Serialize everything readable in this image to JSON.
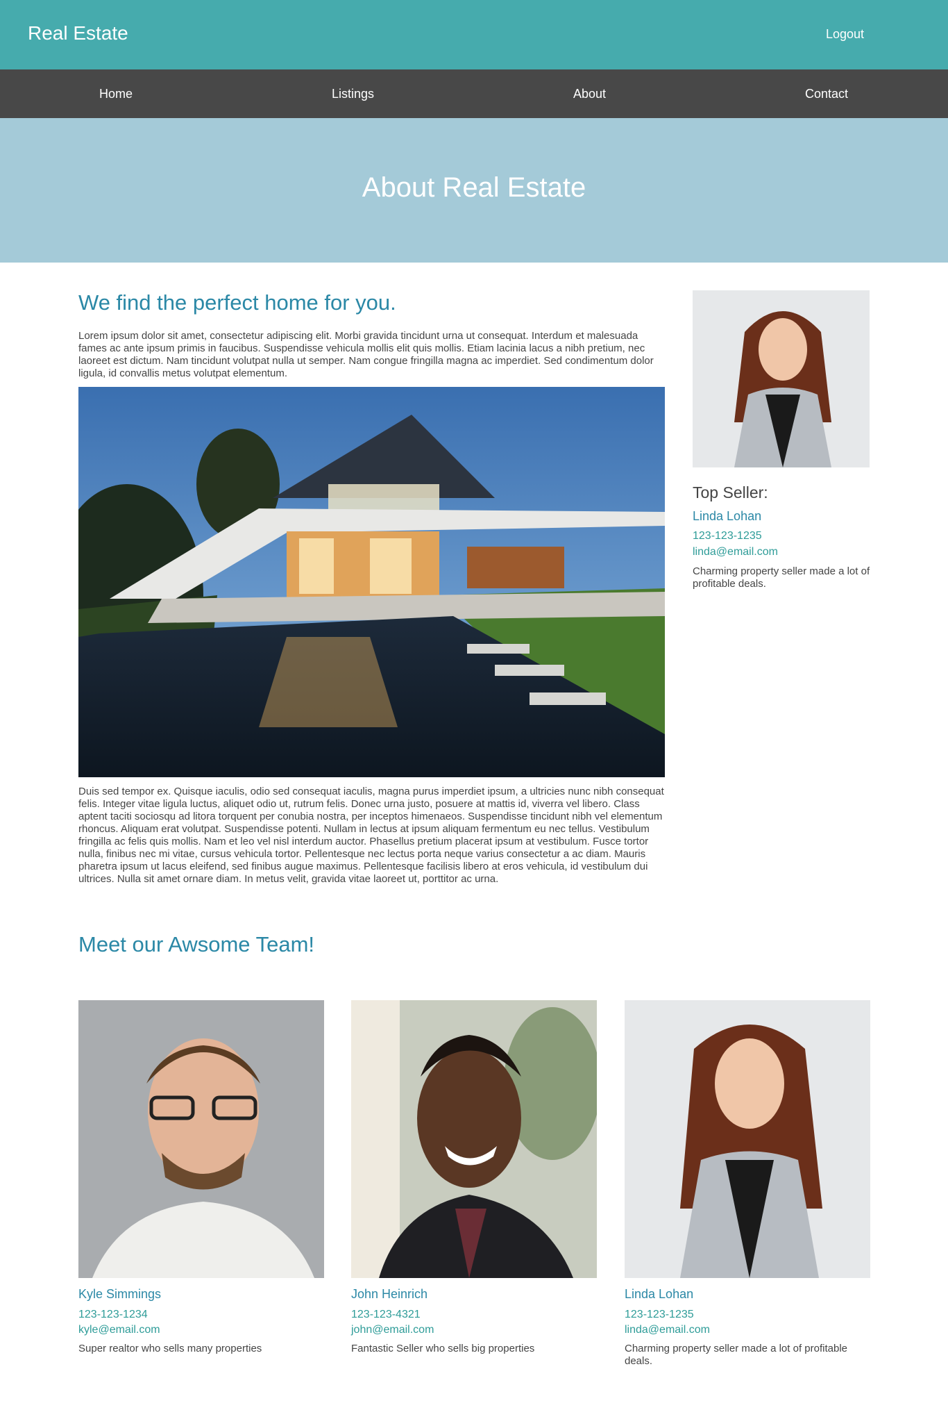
{
  "header": {
    "brand": "Real Estate",
    "logout": "Logout"
  },
  "nav": {
    "items": [
      "Home",
      "Listings",
      "About",
      "Contact"
    ]
  },
  "hero": {
    "title": "About Real Estate"
  },
  "main": {
    "heading": "We find the perfect home for you.",
    "intro": "Lorem ipsum dolor sit amet, consectetur adipiscing elit. Morbi gravida tincidunt urna ut consequat. Interdum et malesuada fames ac ante ipsum primis in faucibus. Suspendisse vehicula mollis elit quis mollis. Etiam lacinia lacus a nibh pretium, nec laoreet est dictum. Nam tincidunt volutpat nulla ut semper. Nam congue fringilla magna ac imperdiet. Sed condimentum dolor ligula, id convallis metus volutpat elementum.",
    "body": "Duis sed tempor ex. Quisque iaculis, odio sed consequat iaculis, magna purus imperdiet ipsum, a ultricies nunc nibh consequat felis. Integer vitae ligula luctus, aliquet odio ut, rutrum felis. Donec urna justo, posuere at mattis id, viverra vel libero. Class aptent taciti sociosqu ad litora torquent per conubia nostra, per inceptos himenaeos. Suspendisse tincidunt nibh vel elementum rhoncus. Aliquam erat volutpat. Suspendisse potenti. Nullam in lectus at ipsum aliquam fermentum eu nec tellus. Vestibulum fringilla ac felis quis mollis. Nam et leo vel nisl interdum auctor. Phasellus pretium placerat ipsum at vestibulum. Fusce tortor nulla, finibus nec mi vitae, cursus vehicula tortor. Pellentesque nec lectus porta neque varius consectetur a ac diam. Mauris pharetra ipsum ut lacus eleifend, sed finibus augue maximus. Pellentesque facilisis libero at eros vehicula, id vestibulum dui ultrices. Nulla sit amet ornare diam. In metus velit, gravida vitae laoreet ut, porttitor ac urna."
  },
  "sidebar": {
    "label": "Top Seller:",
    "name": "Linda Lohan",
    "phone": "123-123-1235",
    "email": "linda@email.com",
    "desc": "Charming property seller made a lot of profitable deals."
  },
  "team": {
    "heading": "Meet our Awsome Team!",
    "members": [
      {
        "name": "Kyle Simmings",
        "phone": "123-123-1234",
        "email": "kyle@email.com",
        "desc": "Super realtor who sells many properties"
      },
      {
        "name": "John Heinrich",
        "phone": "123-123-4321",
        "email": "john@email.com",
        "desc": "Fantastic Seller who sells big properties"
      },
      {
        "name": "Linda Lohan",
        "phone": "123-123-1235",
        "email": "linda@email.com",
        "desc": "Charming property seller made a lot of profitable deals."
      }
    ]
  },
  "colors": {
    "header": "#46abad",
    "nav": "#484848",
    "hero": "#a4cad8",
    "accent": "#2b88a6",
    "contact": "#2e9c98"
  }
}
